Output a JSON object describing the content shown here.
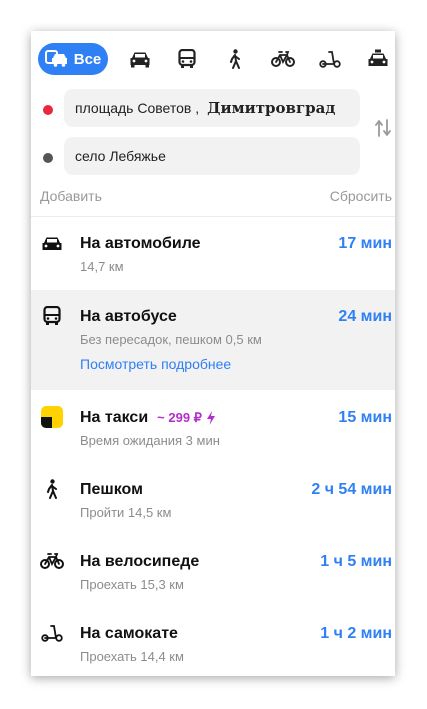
{
  "modes": {
    "all_label": "Все",
    "icons": [
      "multimodal-car-bus-icon",
      "car-icon",
      "bus-icon",
      "pedestrian-icon",
      "bicycle-icon",
      "scooter-icon",
      "taxi-icon"
    ]
  },
  "route_inputs": {
    "from": "площадь Советов ,",
    "from_extra": "Димитровград",
    "to": "село Лебяжье"
  },
  "actions": {
    "add": "Добавить",
    "reset": "Сбросить"
  },
  "routes": [
    {
      "icon": "car-icon",
      "title": "На автомобиле",
      "subtitle": "14,7 км",
      "time": "17 мин"
    },
    {
      "icon": "bus-icon",
      "title": "На автобусе",
      "subtitle": "Без пересадок, пешком 0,5 км",
      "time": "24 мин",
      "link": "Посмотреть подробнее",
      "selected": true
    },
    {
      "icon": "yandex-taxi-icon",
      "title": "На такси",
      "price": "~ 299 ₽",
      "subtitle": "Время ожидания 3 мин",
      "time": "15 мин"
    },
    {
      "icon": "pedestrian-icon",
      "title": "Пешком",
      "subtitle": "Пройти 14,5 км",
      "time": "2 ч 54 мин"
    },
    {
      "icon": "bicycle-icon",
      "title": "На велосипеде",
      "subtitle": "Проехать 15,3 км",
      "time": "1 ч 5 мин"
    },
    {
      "icon": "scooter-icon",
      "title": "На самокате",
      "subtitle": "Проехать 14,4 км",
      "time": "1 ч 2 мин"
    }
  ],
  "colors": {
    "accent": "#2f7ff5",
    "origin_dot": "#e8283c",
    "destination_dot": "#555555",
    "taxi_price": "#b22fc9",
    "taxi_logo": "#ffd200"
  }
}
